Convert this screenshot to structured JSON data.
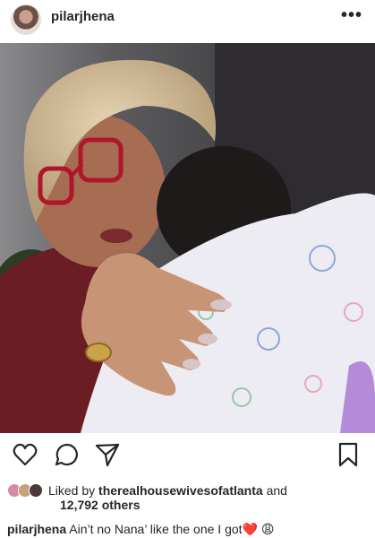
{
  "post": {
    "username": "pilarjhena",
    "more_glyph": "•••"
  },
  "photo": {
    "icon": "photo-grandmother-holding-baby"
  },
  "actions": {
    "icons": [
      "heart-icon",
      "comment-icon",
      "share-icon",
      "bookmark-icon"
    ]
  },
  "likes": {
    "prefix": "Liked by",
    "account": "therealhousewivesofatlanta",
    "conjunction": "and",
    "others": "12,792 others"
  },
  "caption": {
    "username": "pilarjhena",
    "text": "Ain’t no Nana’ like the one I got",
    "emojis": "❤️ 😩"
  }
}
